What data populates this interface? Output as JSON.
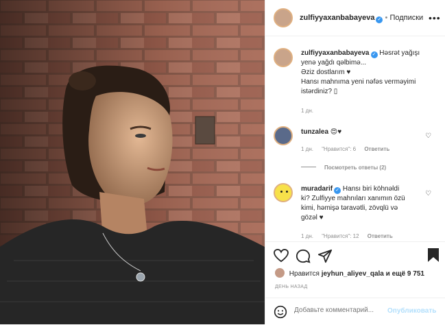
{
  "post": {
    "username": "zulfiyyaxanbabayeva",
    "follow_label": "Подписки",
    "caption_user": "zulfiyyaxanbabayeva",
    "caption_lines": [
      "Həsrət yağışı",
      "yenə yağdı qəlbimə...",
      "Əziz dostlarım ♥",
      "Hansı mahnıma yeni nəfəs verməyimi",
      "istərdiniz? ▯"
    ],
    "caption_time": "1 дн.",
    "likes_text_prefix": "Нравится",
    "likes_user": "jeyhun_aliyev_qala",
    "likes_text_suffix": "и ещё 9 751",
    "date_label": "ДЕНЬ НАЗАД"
  },
  "comments": [
    {
      "user": "tunzalea",
      "text": "😍♥",
      "time": "1 дн.",
      "likes": "\"Нравится\": 6",
      "reply": "Ответить",
      "view_replies": "Посмотреть ответы (2)"
    },
    {
      "user": "muradarif",
      "text_lines": [
        "Hansı biri köhnəldi",
        "ki? Zulfiyye mahnıları xanımın özü",
        "kimi, həmişə təravətli, zövqlü və",
        "gözəl ♥"
      ],
      "time": "1 дн.",
      "likes": "\"Нравится\": 12",
      "reply": "Ответить"
    }
  ],
  "add_comment": {
    "placeholder": "Добавьте комментарий...",
    "publish_label": "Опубликовать"
  },
  "colors": {
    "link_blue": "#3897f0",
    "publish_blue": "#b2dffc",
    "muted": "#8e8e8e"
  }
}
